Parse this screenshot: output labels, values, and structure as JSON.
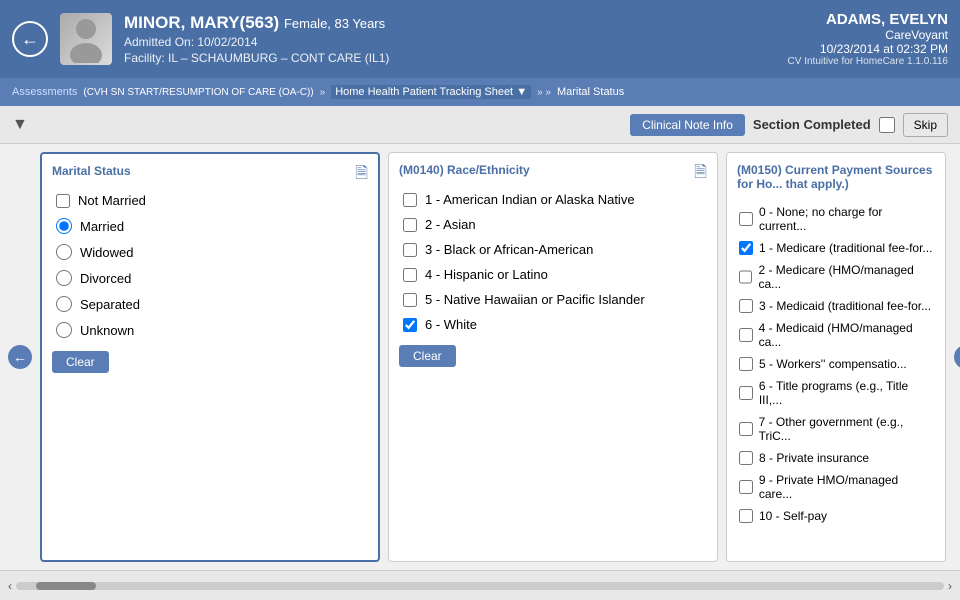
{
  "header": {
    "back_label": "←",
    "patient_name": "MINOR, MARY(563)",
    "patient_gender_age": "Female, 83 Years",
    "admitted_label": "Admitted On: 10/02/2014",
    "facility_label": "Facility: IL – SCHAUMBURG – CONT CARE (IL1)",
    "user_name": "ADAMS, EVELYN",
    "user_org": "CareVoyant",
    "datetime": "10/23/2014 at 02:32 PM",
    "cv_version": "CV Intuitive for HomeCare 1.1.0.116"
  },
  "breadcrumb": {
    "assessments": "Assessments",
    "assessment_code": "(CVH SN START/RESUMPTION OF CARE (OA-C))",
    "separator1": "»",
    "tracking_sheet": "Home Health Patient Tracking Sheet",
    "separator2": "»",
    "current": "Marital Status"
  },
  "toolbar": {
    "dropdown_label": "▼",
    "clinical_note_btn": "Clinical Note Info",
    "section_completed_label": "Section Completed",
    "skip_label": "Skip"
  },
  "marital_status": {
    "title": "Marital Status",
    "options": [
      {
        "id": "not_married",
        "label": "Not Married",
        "selected": false,
        "type": "checkbox"
      },
      {
        "id": "married",
        "label": "Married",
        "selected": true,
        "type": "radio"
      },
      {
        "id": "widowed",
        "label": "Widowed",
        "selected": false,
        "type": "radio"
      },
      {
        "id": "divorced",
        "label": "Divorced",
        "selected": false,
        "type": "radio"
      },
      {
        "id": "separated",
        "label": "Separated",
        "selected": false,
        "type": "radio"
      },
      {
        "id": "unknown",
        "label": "Unknown",
        "selected": false,
        "type": "radio"
      }
    ],
    "clear_label": "Clear"
  },
  "race_ethnicity": {
    "title": "(M0140) Race/Ethnicity",
    "options": [
      {
        "id": "r1",
        "label": "1 - American Indian or Alaska Native",
        "selected": false
      },
      {
        "id": "r2",
        "label": "2 - Asian",
        "selected": false
      },
      {
        "id": "r3",
        "label": "3 - Black or African-American",
        "selected": false
      },
      {
        "id": "r4",
        "label": "4 - Hispanic or Latino",
        "selected": false
      },
      {
        "id": "r5",
        "label": "5 - Native Hawaiian or Pacific Islander",
        "selected": false
      },
      {
        "id": "r6",
        "label": "6 - White",
        "selected": true
      }
    ],
    "clear_label": "Clear"
  },
  "payment_sources": {
    "title": "(M0150) Current Payment Sources for Ho... that apply.)",
    "options": [
      {
        "id": "p0",
        "label": "0 - None; no charge for current...",
        "selected": false
      },
      {
        "id": "p1",
        "label": "1 - Medicare (traditional fee-for...",
        "selected": true
      },
      {
        "id": "p2",
        "label": "2 - Medicare (HMO/managed ca...",
        "selected": false
      },
      {
        "id": "p3",
        "label": "3 - Medicaid (traditional fee-for...",
        "selected": false
      },
      {
        "id": "p4",
        "label": "4 - Medicaid (HMO/managed ca...",
        "selected": false
      },
      {
        "id": "p5",
        "label": "5 - Workers' compensatio...",
        "selected": false
      },
      {
        "id": "p6",
        "label": "6 - Title programs (e.g., Title III,...",
        "selected": false
      },
      {
        "id": "p7",
        "label": "7 - Other government (e.g., TriC...",
        "selected": false
      },
      {
        "id": "p8",
        "label": "8 - Private insurance",
        "selected": false
      },
      {
        "id": "p9",
        "label": "9 - Private HMO/managed care...",
        "selected": false
      },
      {
        "id": "p10",
        "label": "10 - Self-pay",
        "selected": false
      }
    ]
  }
}
